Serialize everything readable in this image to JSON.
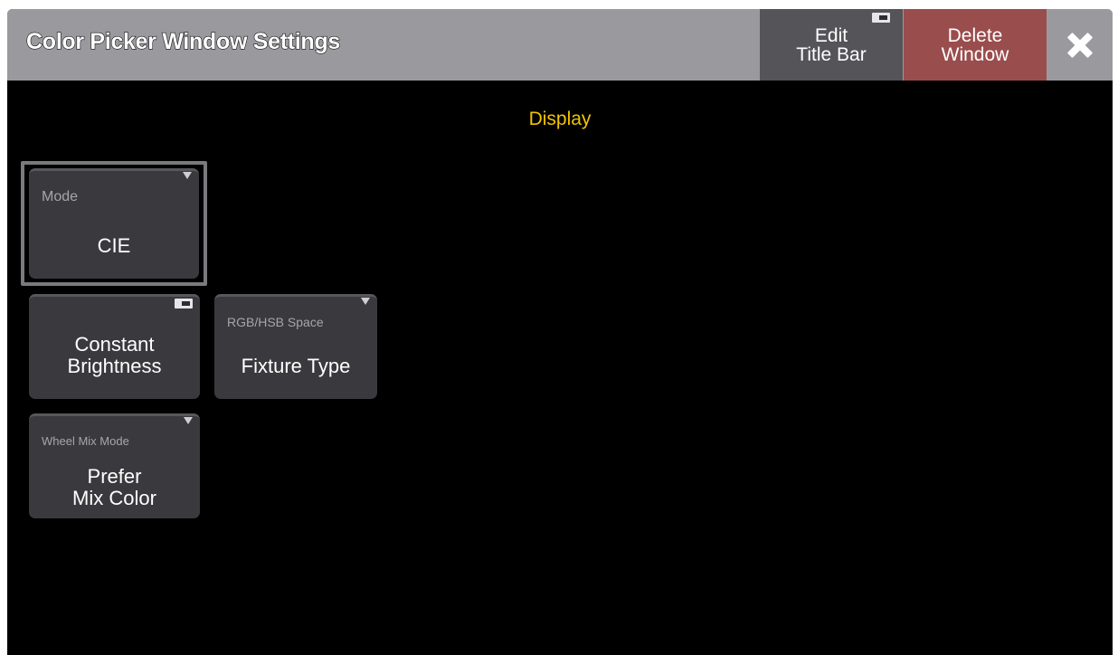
{
  "window": {
    "title": "Color Picker Window Settings",
    "buttons": {
      "edit_title_bar": "Edit\nTitle Bar",
      "delete_window": "Delete\nWindow"
    }
  },
  "section": {
    "title": "Display"
  },
  "settings": {
    "mode": {
      "label": "Mode",
      "value": "CIE"
    },
    "constant_brightness": {
      "value": "Constant\nBrightness"
    },
    "rgb_hsb_space": {
      "label": "RGB/HSB Space",
      "value": "Fixture Type"
    },
    "wheel_mix_mode": {
      "label": "Wheel Mix Mode",
      "value": "Prefer\nMix Color"
    }
  },
  "colors": {
    "titlebar": "#9a9a9e",
    "delete_button": "#9a4d4d",
    "section_title": "#f2c300",
    "card": "#3a3a3e"
  }
}
